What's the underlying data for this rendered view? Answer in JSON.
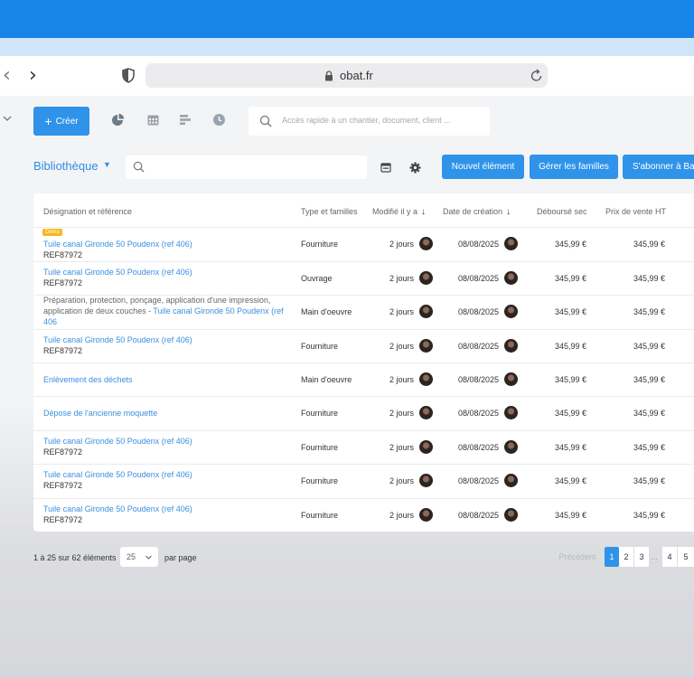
{
  "browser": {
    "url": "obat.fr",
    "back_icon": "‹",
    "forward_icon": "›"
  },
  "toolbar": {
    "create_label": "Créer",
    "create_plus": "+",
    "search_placeholder": "Accès rapide à un chantier, document, client ..."
  },
  "library": {
    "title": "Bibliothèque",
    "caret": "▼",
    "buttons": {
      "new_element": "Nouvel élément",
      "manage_families": "Gérer les familles",
      "subscribe": "S'abonner à Bat"
    }
  },
  "table": {
    "headers": {
      "designation": "Désignation et référence",
      "type": "Type et familles",
      "modified": "Modifié il y a",
      "created": "Date de création",
      "cost": "Déboursé sec",
      "price": "Prix de vente HT"
    },
    "sort_icon": "↓",
    "rows": [
      {
        "badge": "Démo",
        "line1": "Tuile canal Gironde 50 Poudenx (ref 406)",
        "ref": "REF87972",
        "type": "Fourniture",
        "modified": "2 jours",
        "created": "08/08/2025",
        "cost": "345,99 €",
        "price": "345,99 €"
      },
      {
        "line1": "Tuile canal Gironde 50 Poudenx (ref 406)",
        "ref": "REF87972",
        "type": "Ouvrage",
        "modified": "2 jours",
        "created": "08/08/2025",
        "cost": "345,99 €",
        "price": "345,99 €"
      },
      {
        "desc_a": "Préparation, protection, ponçage, application d'une impression,",
        "desc_b": "application de deux couches - ",
        "desc_link_b": "Tuile canal Gironde 50 Poudenx (ref",
        "desc_link_c": "406",
        "type": "Main d'oeuvre",
        "modified": "2 jours",
        "created": "08/08/2025",
        "cost": "345,99 €",
        "price": "345,99 €"
      },
      {
        "line1": "Tuile canal Gironde 50 Poudenx (ref 406)",
        "ref": "REF87972",
        "type": "Fourniture",
        "modified": "2 jours",
        "created": "08/08/2025",
        "cost": "345,99 €",
        "price": "345,99 €"
      },
      {
        "line1": "Enlèvement des déchets",
        "type": "Main d'oeuvre",
        "modified": "2 jours",
        "created": "08/08/2025",
        "cost": "345,99 €",
        "price": "345,99 €"
      },
      {
        "line1": "Dépose de l'ancienne moquette",
        "type": "Fourniture",
        "modified": "2 jours",
        "created": "08/08/2025",
        "cost": "345,99 €",
        "price": "345,99 €"
      },
      {
        "line1": "Tuile canal Gironde 50 Poudenx (ref 406)",
        "ref": "REF87972",
        "type": "Fourniture",
        "modified": "2 jours",
        "created": "08/08/2025",
        "cost": "345,99 €",
        "price": "345,99 €"
      },
      {
        "line1": "Tuile canal Gironde 50 Poudenx (ref 406)",
        "ref": "REF87972",
        "type": "Fourniture",
        "modified": "2 jours",
        "created": "08/08/2025",
        "cost": "345,99 €",
        "price": "345,99 €"
      },
      {
        "line1": "Tuile canal Gironde 50 Poudenx (ref 406)",
        "ref": "REF87972",
        "type": "Fourniture",
        "modified": "2 jours",
        "created": "08/08/2025",
        "cost": "345,99 €",
        "price": "345,99 €"
      }
    ]
  },
  "footer": {
    "range": "1 à 25 sur 62 éléments",
    "per_page_value": "25",
    "per_page_label": "par page",
    "prev": "Précédent",
    "pages": [
      "1",
      "2",
      "3"
    ],
    "dots": "...",
    "pages_end": [
      "4",
      "5"
    ]
  },
  "colors": {
    "brand": "#1784ea",
    "button": "#2f93ea",
    "link": "#3a8fdf",
    "badge": "#f5b81c"
  }
}
